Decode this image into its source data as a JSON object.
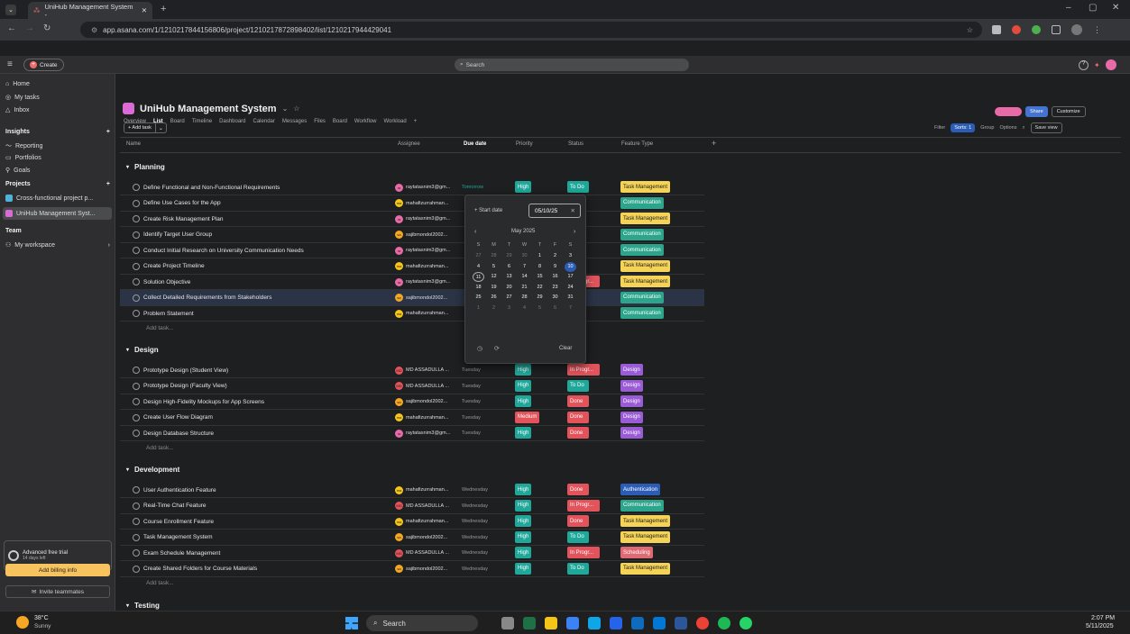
{
  "browser": {
    "tab_title": "UniHub Management System -",
    "url": "app.asana.com/1/1210217844156806/project/1210217872898402/list/1210217944429041"
  },
  "topbar": {
    "create_label": "Create",
    "search_placeholder": "Search"
  },
  "sidebar": {
    "items": [
      {
        "label": "Home"
      },
      {
        "label": "My tasks"
      },
      {
        "label": "Inbox"
      },
      {
        "label": "Insights"
      },
      {
        "label": "Reporting"
      },
      {
        "label": "Portfolios"
      },
      {
        "label": "Goals"
      },
      {
        "label": "Projects"
      },
      {
        "label": "Cross-functional project p..."
      },
      {
        "label": "UniHub Management Syst..."
      },
      {
        "label": "Team"
      },
      {
        "label": "My workspace"
      }
    ],
    "trial_title": "Advanced free trial",
    "trial_days": "14 days left",
    "billing_label": "Add billing info",
    "invite_label": "Invite teammates"
  },
  "project": {
    "title": "UniHub Management System",
    "tabs": [
      "Overview",
      "List",
      "Board",
      "Timeline",
      "Dashboard",
      "Calendar",
      "Messages",
      "Files",
      "Board",
      "Workflow",
      "Workload"
    ],
    "share_label": "Share",
    "customize_label": "Customize",
    "add_task_label": "+ Add task",
    "filter_label": "Filter",
    "sorts_label": "Sorts: 1",
    "group_label": "Group",
    "options_label": "Options",
    "save_view_label": "Save view"
  },
  "columns": [
    "Name",
    "Assignee",
    "Due date",
    "Priority",
    "Status",
    "Feature Type"
  ],
  "sections": [
    {
      "name": "Planning",
      "tasks": [
        {
          "name": "Define Functional and Non-Functional Requirements",
          "assignee": "raytatasnim3@gm...",
          "due": "Tomorrow",
          "priority": "High",
          "status": "To Do",
          "feature": "Task Management"
        },
        {
          "name": "Define Use Cases for the App",
          "assignee": "mahafizurrahman...",
          "due": "",
          "priority": "",
          "status": "",
          "feature": "Communication"
        },
        {
          "name": "Create Risk Management Plan",
          "assignee": "raytatasnim3@gm...",
          "due": "",
          "priority": "",
          "status": "",
          "feature": "Task Management"
        },
        {
          "name": "Identify Target User Group",
          "assignee": "sajibmondol2002...",
          "due": "",
          "priority": "",
          "status": "",
          "feature": "Communication"
        },
        {
          "name": "Conduct Initial Research on University Communication Needs",
          "assignee": "raytatasnim3@gm...",
          "due": "",
          "priority": "",
          "status": "",
          "feature": "Communication"
        },
        {
          "name": "Create Project Timeline",
          "assignee": "mahafizurrahman...",
          "due": "",
          "priority": "",
          "status": "",
          "feature": "Task Management"
        },
        {
          "name": "Solution Objective",
          "assignee": "raytatasnim3@gm...",
          "due": "",
          "priority": "",
          "status": "In Progr...",
          "feature": "Task Management"
        },
        {
          "name": "Collect Detailed Requirements from Stakeholders",
          "assignee": "sajibmondol2002...",
          "due": "",
          "priority": "",
          "status": "",
          "feature": "Communication"
        },
        {
          "name": "Problem Statement",
          "assignee": "mahafizurrahman...",
          "due": "",
          "priority": "",
          "status": "",
          "feature": "Communication"
        }
      ]
    },
    {
      "name": "Design",
      "tasks": [
        {
          "name": "Prototype Design (Student View)",
          "assignee": "MD ASSADULLA ...",
          "due": "Tuesday",
          "priority": "High",
          "status": "In Progr...",
          "feature": "Design"
        },
        {
          "name": "Prototype Design (Faculty View)",
          "assignee": "MD ASSADULLA ...",
          "due": "Tuesday",
          "priority": "High",
          "status": "To Do",
          "feature": "Design"
        },
        {
          "name": "Design High-Fidelity Mockups for App Screens",
          "assignee": "sajibmondol2002...",
          "due": "Tuesday",
          "priority": "High",
          "status": "Done",
          "feature": "Design"
        },
        {
          "name": "Create User Flow Diagram",
          "assignee": "mahafizurrahman...",
          "due": "Tuesday",
          "priority": "Medium",
          "status": "Done",
          "feature": "Design"
        },
        {
          "name": "Design Database Structure",
          "assignee": "raytatasnim3@gm...",
          "due": "Tuesday",
          "priority": "High",
          "status": "Done",
          "feature": "Design"
        }
      ]
    },
    {
      "name": "Development",
      "tasks": [
        {
          "name": "User Authentication Feature",
          "assignee": "mahafizurrahman...",
          "due": "Wednesday",
          "priority": "High",
          "status": "Done",
          "feature": "Authentication"
        },
        {
          "name": "Real-Time Chat Feature",
          "assignee": "MD ASSADULLA ...",
          "due": "Wednesday",
          "priority": "High",
          "status": "In Progr...",
          "feature": "Communication"
        },
        {
          "name": "Course Enrollment Feature",
          "assignee": "mahafizurrahman...",
          "due": "Wednesday",
          "priority": "High",
          "status": "Done",
          "feature": "Task Management"
        },
        {
          "name": "Task Management System",
          "assignee": "sajibmondol2002...",
          "due": "Wednesday",
          "priority": "High",
          "status": "To Do",
          "feature": "Task Management"
        },
        {
          "name": "Exam Schedule Management",
          "assignee": "MD ASSADULLA ...",
          "due": "Wednesday",
          "priority": "High",
          "status": "In Progr...",
          "feature": "Scheduling"
        },
        {
          "name": "Create Shared Folders for Course Materials",
          "assignee": "sajibmondol2002...",
          "due": "Wednesday",
          "priority": "High",
          "status": "To Do",
          "feature": "Task Management"
        }
      ]
    },
    {
      "name": "Testing",
      "tasks": []
    }
  ],
  "add_task_row": "Add task...",
  "datepicker": {
    "start_label": "+ Start date",
    "date_value": "05/10/25",
    "month": "May 2025",
    "weekdays": [
      "S",
      "M",
      "T",
      "W",
      "T",
      "F",
      "S"
    ],
    "weeks": [
      [
        "27",
        "28",
        "29",
        "30",
        "1",
        "2",
        "3"
      ],
      [
        "4",
        "5",
        "6",
        "7",
        "8",
        "9",
        "10"
      ],
      [
        "11",
        "12",
        "13",
        "14",
        "15",
        "16",
        "17"
      ],
      [
        "18",
        "19",
        "20",
        "21",
        "22",
        "23",
        "24"
      ],
      [
        "25",
        "26",
        "27",
        "28",
        "29",
        "30",
        "31"
      ],
      [
        "1",
        "2",
        "3",
        "4",
        "5",
        "6",
        "7"
      ]
    ],
    "clear_label": "Clear"
  },
  "taskbar": {
    "weather_temp": "38°C",
    "weather_desc": "Sunny",
    "search_label": "Search",
    "time": "2:07 PM",
    "date": "5/11/2025"
  },
  "colors": {
    "high": "#1fa89a",
    "medium": "#e3535b",
    "todo": "#1fa89a",
    "inprog": "#e3535b",
    "done": "#e3535b",
    "taskmgmt": "#f5d357",
    "communication": "#2da58c",
    "design": "#9a5bd6",
    "authentication": "#2b5db6",
    "scheduling": "#e06a73"
  }
}
